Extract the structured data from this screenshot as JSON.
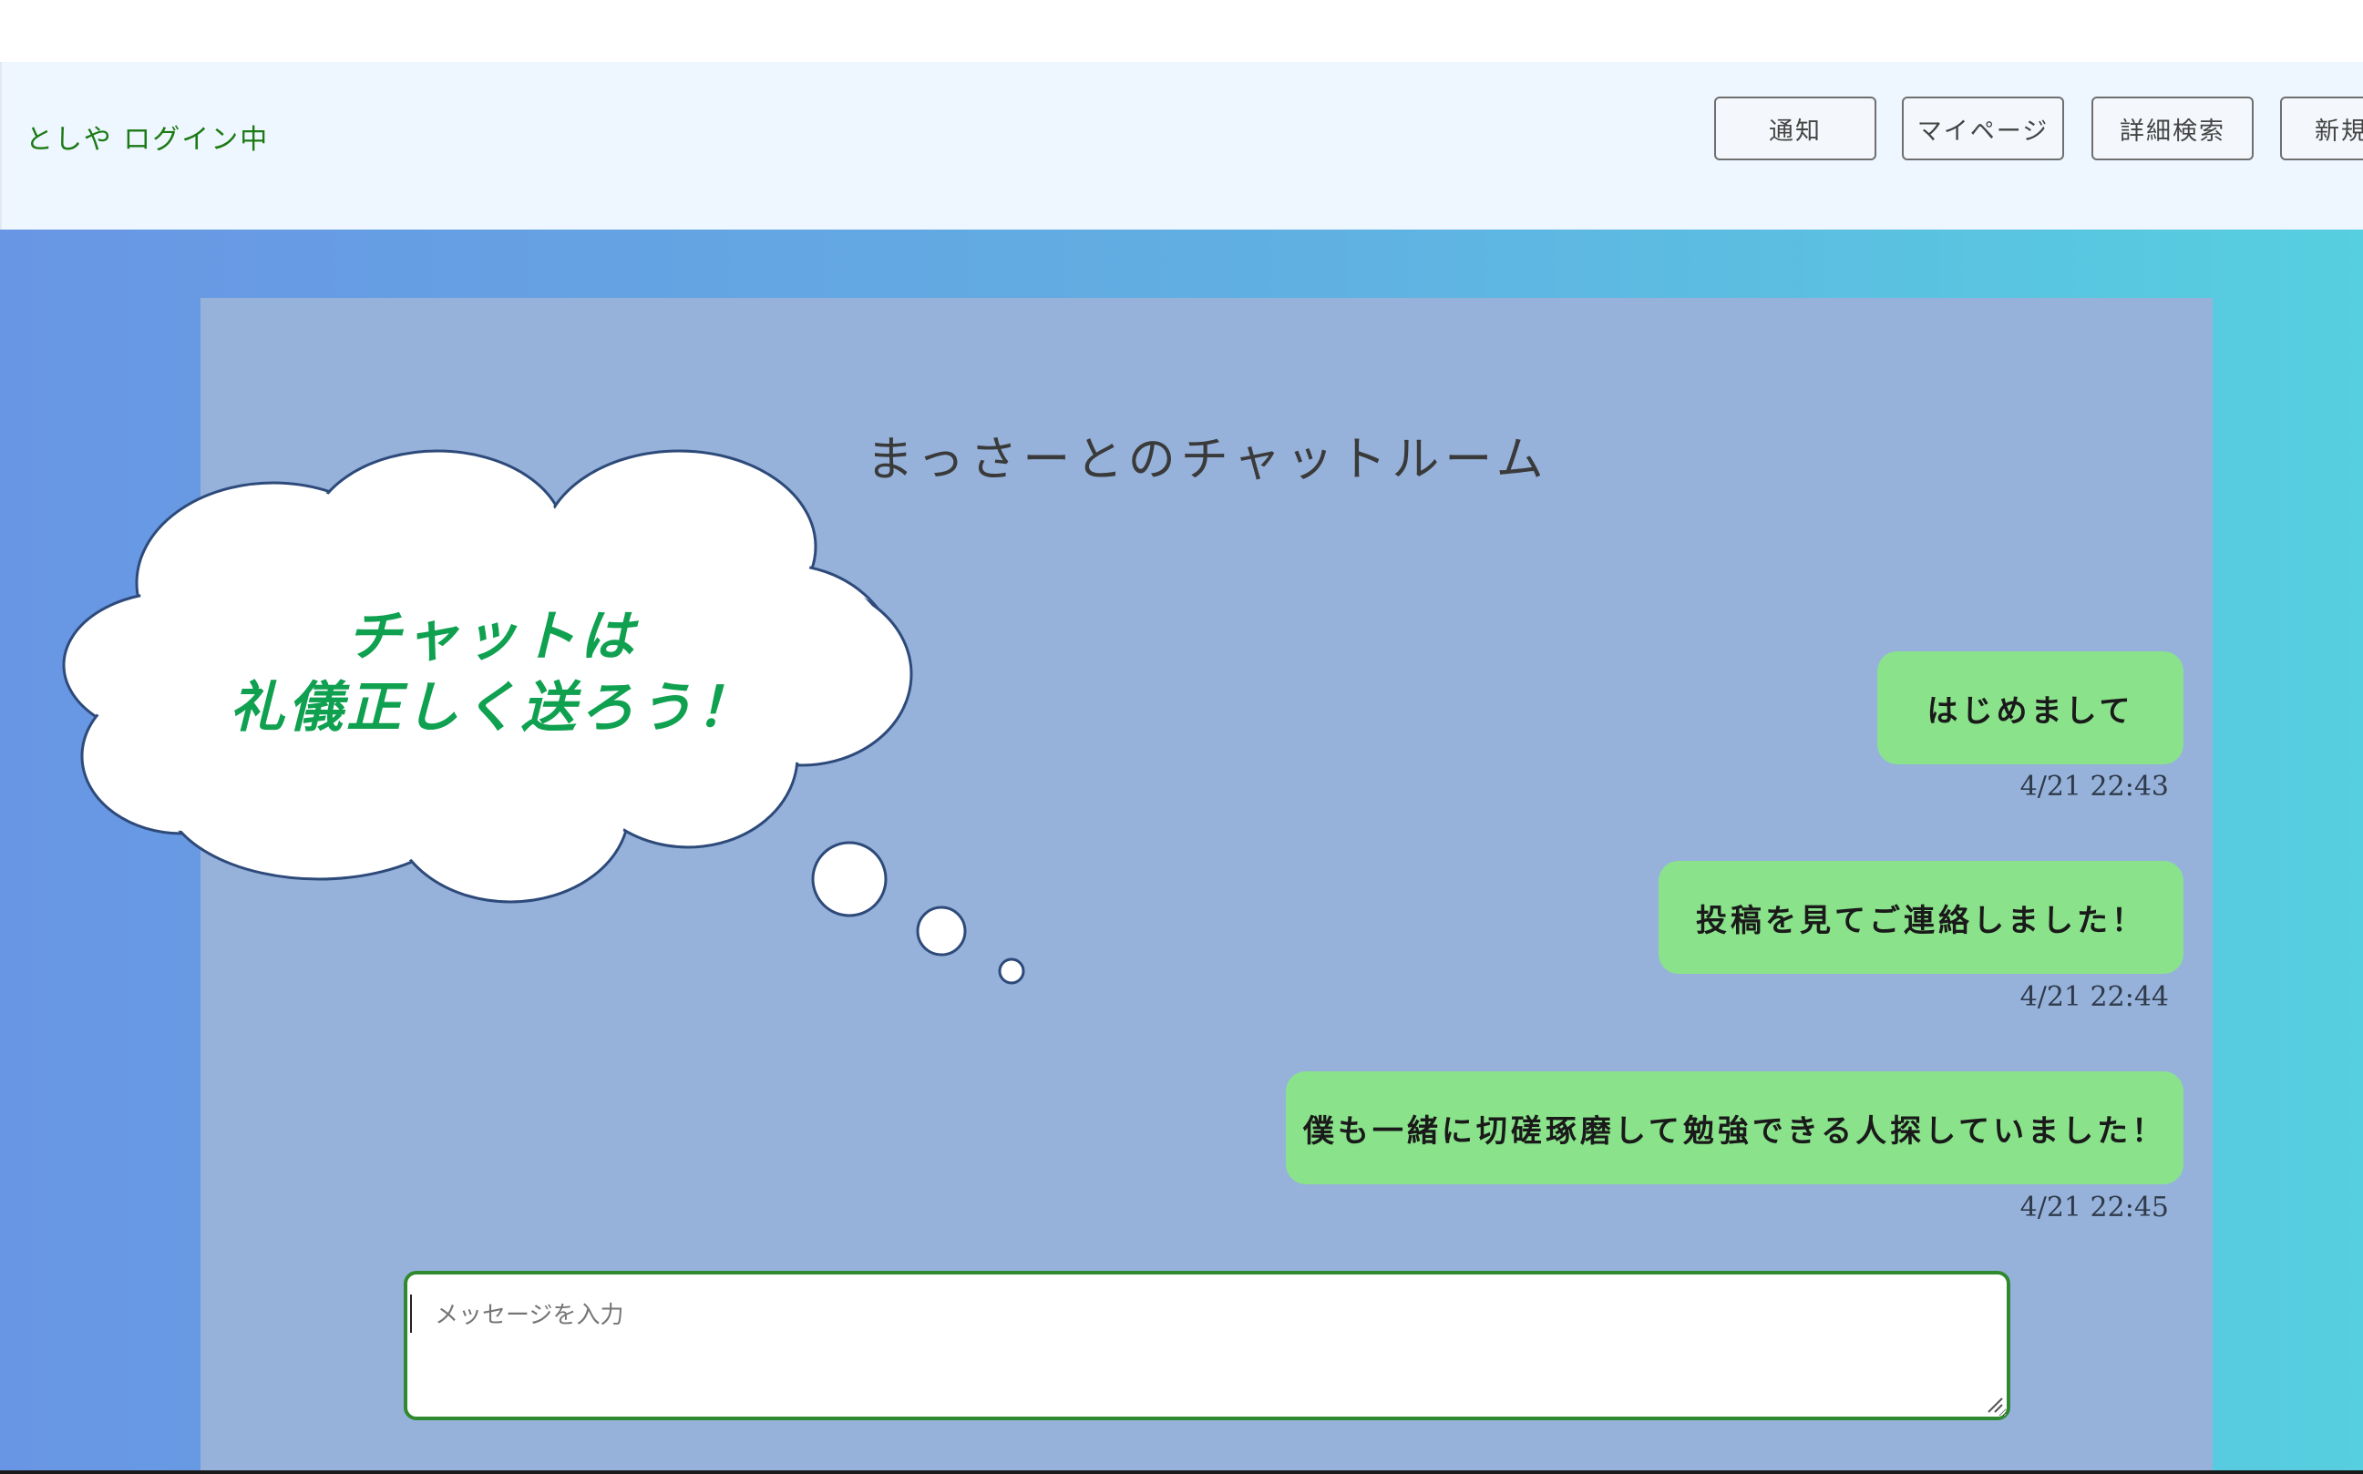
{
  "header": {
    "login_status": "としや ログイン中",
    "buttons": {
      "notify": "通知",
      "mypage": "マイページ",
      "advanced_search": "詳細検索",
      "new": "新規"
    }
  },
  "chat": {
    "title": "まっさーとのチャットルーム",
    "messages": [
      {
        "text": "はじめまして",
        "time": "4/21 22:43"
      },
      {
        "text": "投稿を見てご連絡しました！",
        "time": "4/21 22:44"
      },
      {
        "text": "僕も一緒に切磋琢磨して勉強できる人探していました！",
        "time": "4/21 22:45"
      }
    ],
    "input": {
      "placeholder": "メッセージを入力",
      "value": ""
    }
  },
  "callout": {
    "line1": "チャットは",
    "line2": "礼儀正しく送ろう！"
  },
  "colors": {
    "header_bg": "#eef6ff",
    "login_text": "#1b7a14",
    "bubble_bg": "#8ae38b",
    "panel_bg": "#96b2da",
    "callout_text": "#0fa050",
    "input_border": "#2f8a2f"
  }
}
